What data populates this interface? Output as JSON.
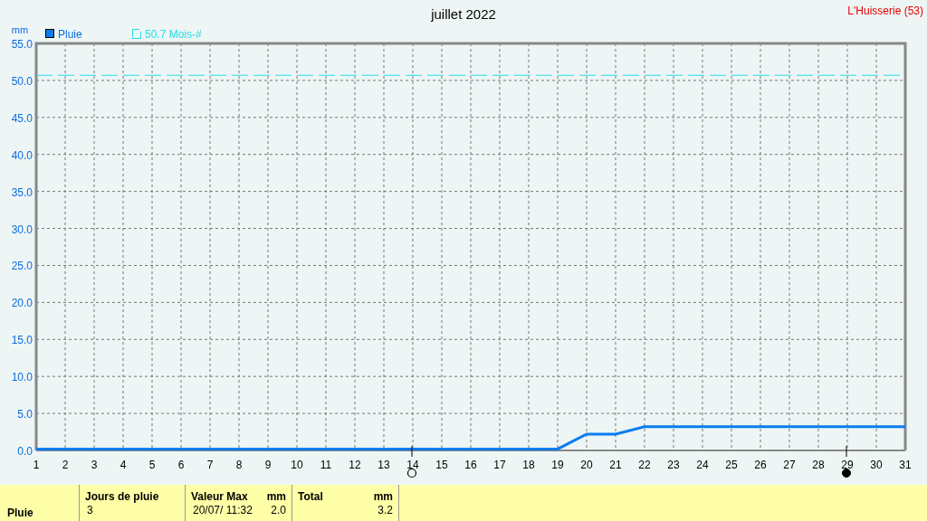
{
  "location": "L'Huisserie (53)",
  "chart": {
    "chart_data": {
      "type": "line",
      "title": "juillet 2022",
      "ylabel": "mm",
      "xlim": [
        1,
        31
      ],
      "ylim": [
        0,
        55
      ],
      "xticks": [
        1,
        2,
        3,
        4,
        5,
        6,
        7,
        8,
        9,
        10,
        11,
        12,
        13,
        14,
        15,
        16,
        17,
        18,
        19,
        20,
        21,
        22,
        23,
        24,
        25,
        26,
        27,
        28,
        29,
        30,
        31
      ],
      "yticks": [
        {
          "value": 0,
          "label": "0.0"
        },
        {
          "value": 5,
          "label": "5.0"
        },
        {
          "value": 10,
          "label": "10.0"
        },
        {
          "value": 15,
          "label": "15.0"
        },
        {
          "value": 20,
          "label": "20.0"
        },
        {
          "value": 25,
          "label": "25.0"
        },
        {
          "value": 30,
          "label": "30.0"
        },
        {
          "value": 35,
          "label": "35.0"
        },
        {
          "value": 40,
          "label": "40.0"
        },
        {
          "value": 45,
          "label": "45.0"
        },
        {
          "value": 50,
          "label": "50.0"
        },
        {
          "value": 55,
          "label": "55.0"
        }
      ],
      "x": [
        1,
        2,
        3,
        4,
        5,
        6,
        7,
        8,
        9,
        10,
        11,
        12,
        13,
        14,
        15,
        16,
        17,
        18,
        19,
        20,
        21,
        22,
        23,
        24,
        25,
        26,
        27,
        28,
        29,
        30,
        31
      ],
      "series": [
        {
          "name": "Pluie",
          "color": "#0a7cf0",
          "line_style": "solid",
          "values": [
            0.2,
            0.2,
            0.2,
            0.2,
            0.2,
            0.2,
            0.2,
            0.2,
            0.2,
            0.2,
            0.2,
            0.2,
            0.2,
            0.2,
            0.2,
            0.2,
            0.2,
            0.2,
            0.2,
            2.2,
            2.2,
            3.2,
            3.2,
            3.2,
            3.2,
            3.2,
            3.2,
            3.2,
            3.2,
            3.2,
            3.2
          ]
        },
        {
          "name": "50.7 Mois-#",
          "color": "#22e0e8",
          "line_style": "dashed",
          "values": [
            50.7,
            50.7,
            50.7,
            50.7,
            50.7,
            50.7,
            50.7,
            50.7,
            50.7,
            50.7,
            50.7,
            50.7,
            50.7,
            50.7,
            50.7,
            50.7,
            50.7,
            50.7,
            50.7,
            50.7,
            50.7,
            50.7,
            50.7,
            50.7,
            50.7,
            50.7,
            50.7,
            50.7,
            50.7,
            50.7,
            50.7
          ]
        }
      ],
      "grid": true,
      "legend": true
    },
    "moon_phases": [
      {
        "kind": "full-moon",
        "day": "14"
      },
      {
        "kind": "new-moon",
        "day": "29"
      }
    ]
  },
  "summary": {
    "row_label": "Pluie",
    "columns": [
      {
        "heading": "Jours de pluie",
        "values": [
          "3"
        ]
      },
      {
        "heading": "Valeur Max",
        "unit": "mm",
        "values": [
          "20/07/ 11:32",
          "2.0"
        ]
      },
      {
        "heading": "Total",
        "unit": "mm",
        "values": [
          "3.2"
        ]
      }
    ]
  }
}
